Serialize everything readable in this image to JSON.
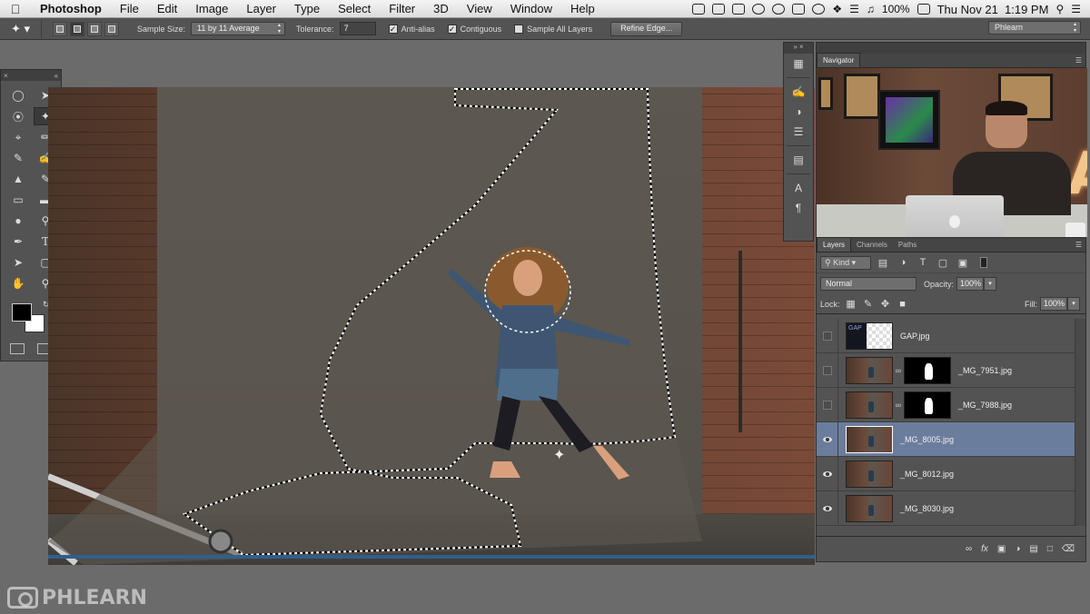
{
  "menubar": {
    "apple": "",
    "items": [
      "Photoshop",
      "File",
      "Edit",
      "Image",
      "Layer",
      "Type",
      "Select",
      "Filter",
      "3D",
      "View",
      "Window",
      "Help"
    ],
    "battery": "100%",
    "clock": "Thu Nov 21  1:19 PM"
  },
  "options": {
    "sample_size_label": "Sample Size:",
    "sample_size_value": "11 by 11 Average",
    "tolerance_label": "Tolerance:",
    "tolerance_value": "7",
    "anti_alias_label": "Anti-alias",
    "anti_alias_checked": true,
    "contiguous_label": "Contiguous",
    "contiguous_checked": true,
    "sample_all_layers_label": "Sample All Layers",
    "sample_all_layers_checked": false,
    "refine_edge_label": "Refine Edge...",
    "workspace_value": "Phlearn"
  },
  "navigator": {
    "tab": "Navigator"
  },
  "layers_panel": {
    "tabs": [
      "Layers",
      "Channels",
      "Paths"
    ],
    "filter_kind": "Kind",
    "blend_mode": "Normal",
    "opacity_label": "Opacity:",
    "opacity_value": "100%",
    "lock_label": "Lock:",
    "fill_label": "Fill:",
    "fill_value": "100%",
    "layers": [
      {
        "name": "GAP.jpg",
        "visible": false,
        "selected": false,
        "has_mask": false
      },
      {
        "name": "_MG_7951.jpg",
        "visible": false,
        "selected": false,
        "has_mask": true
      },
      {
        "name": "_MG_7988.jpg",
        "visible": false,
        "selected": false,
        "has_mask": true
      },
      {
        "name": "_MG_8005.jpg",
        "visible": true,
        "selected": true,
        "has_mask": false
      },
      {
        "name": "_MG_8012.jpg",
        "visible": true,
        "selected": false,
        "has_mask": false
      },
      {
        "name": "_MG_8030.jpg",
        "visible": true,
        "selected": false,
        "has_mask": false
      }
    ]
  },
  "watermark": {
    "brand": "PHLEARN"
  },
  "colors": {
    "selected_layer": "#6b7d9c",
    "panel_bg": "#535353",
    "foreground": "#000000",
    "background": "#ffffff"
  }
}
